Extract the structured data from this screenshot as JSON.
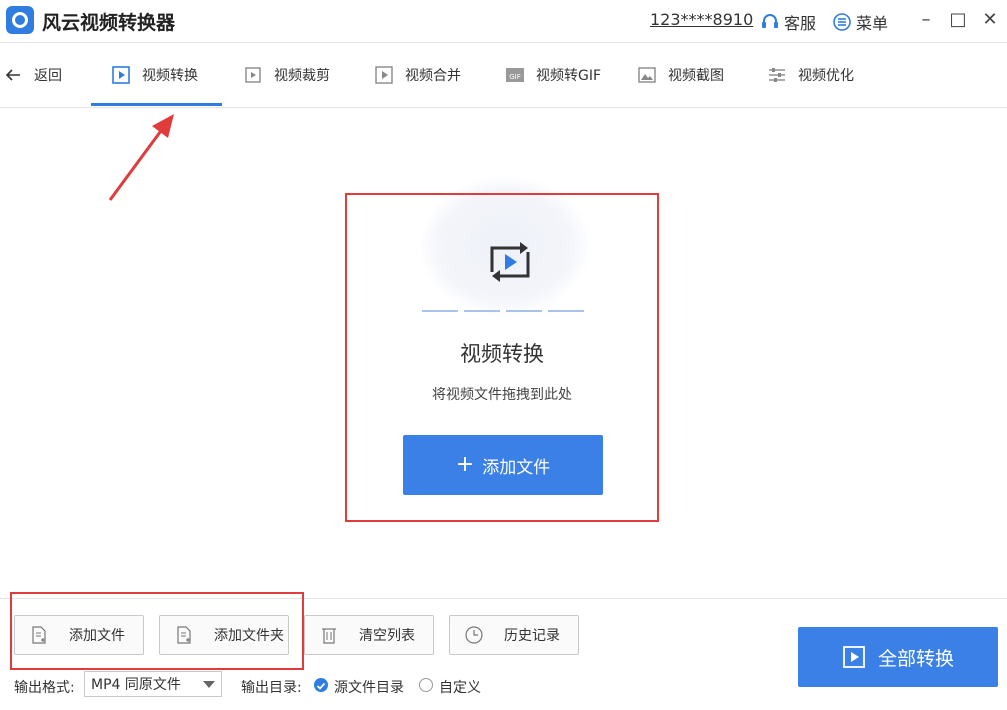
{
  "titlebar": {
    "app_title": "风云视频转换器",
    "user_account": "123****8910",
    "service_label": "客服",
    "menu_label": "菜单"
  },
  "nav": {
    "back_label": "返回",
    "tabs": [
      {
        "label": "视频转换",
        "icon": "video-convert-icon",
        "active": true
      },
      {
        "label": "视频裁剪",
        "icon": "video-crop-icon"
      },
      {
        "label": "视频合并",
        "icon": "video-merge-icon"
      },
      {
        "label": "视频转GIF",
        "icon": "gif-icon"
      },
      {
        "label": "视频截图",
        "icon": "screenshot-icon"
      },
      {
        "label": "视频优化",
        "icon": "optimize-icon"
      }
    ]
  },
  "dropzone": {
    "title": "视频转换",
    "hint": "将视频文件拖拽到此处",
    "add_button": "添加文件"
  },
  "toolbar": {
    "add_file": "添加文件",
    "add_folder": "添加文件夹",
    "clear_list": "清空列表",
    "history": "历史记录"
  },
  "output": {
    "format_label": "输出格式:",
    "format_value": "MP4 同原文件",
    "dir_label": "输出目录:",
    "dir_source": "源文件目录",
    "dir_custom": "自定义",
    "selected": "source"
  },
  "convert_all": "全部转换",
  "colors": {
    "accent": "#3b80e6",
    "annotation": "#e03c3c"
  }
}
